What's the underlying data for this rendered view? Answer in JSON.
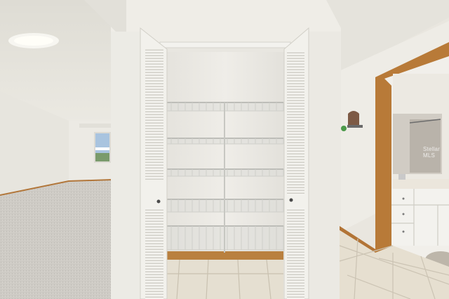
{
  "photo": {
    "subject": "pantry-closet-hallway",
    "colors": {
      "wall": "#eeece6",
      "ceiling": "#e6e4dc",
      "carpet": "#cfccc6",
      "tile": "#e3dccc",
      "trim_wood": "#b97a38",
      "door_louver": "#f4f3ef",
      "shelf_wire": "#d9d9d4",
      "vanity": "#f3f2ee",
      "mirror": "#cfcac3"
    },
    "shelves": {
      "count": 5
    },
    "watermark_text": "Stellar MLS"
  }
}
